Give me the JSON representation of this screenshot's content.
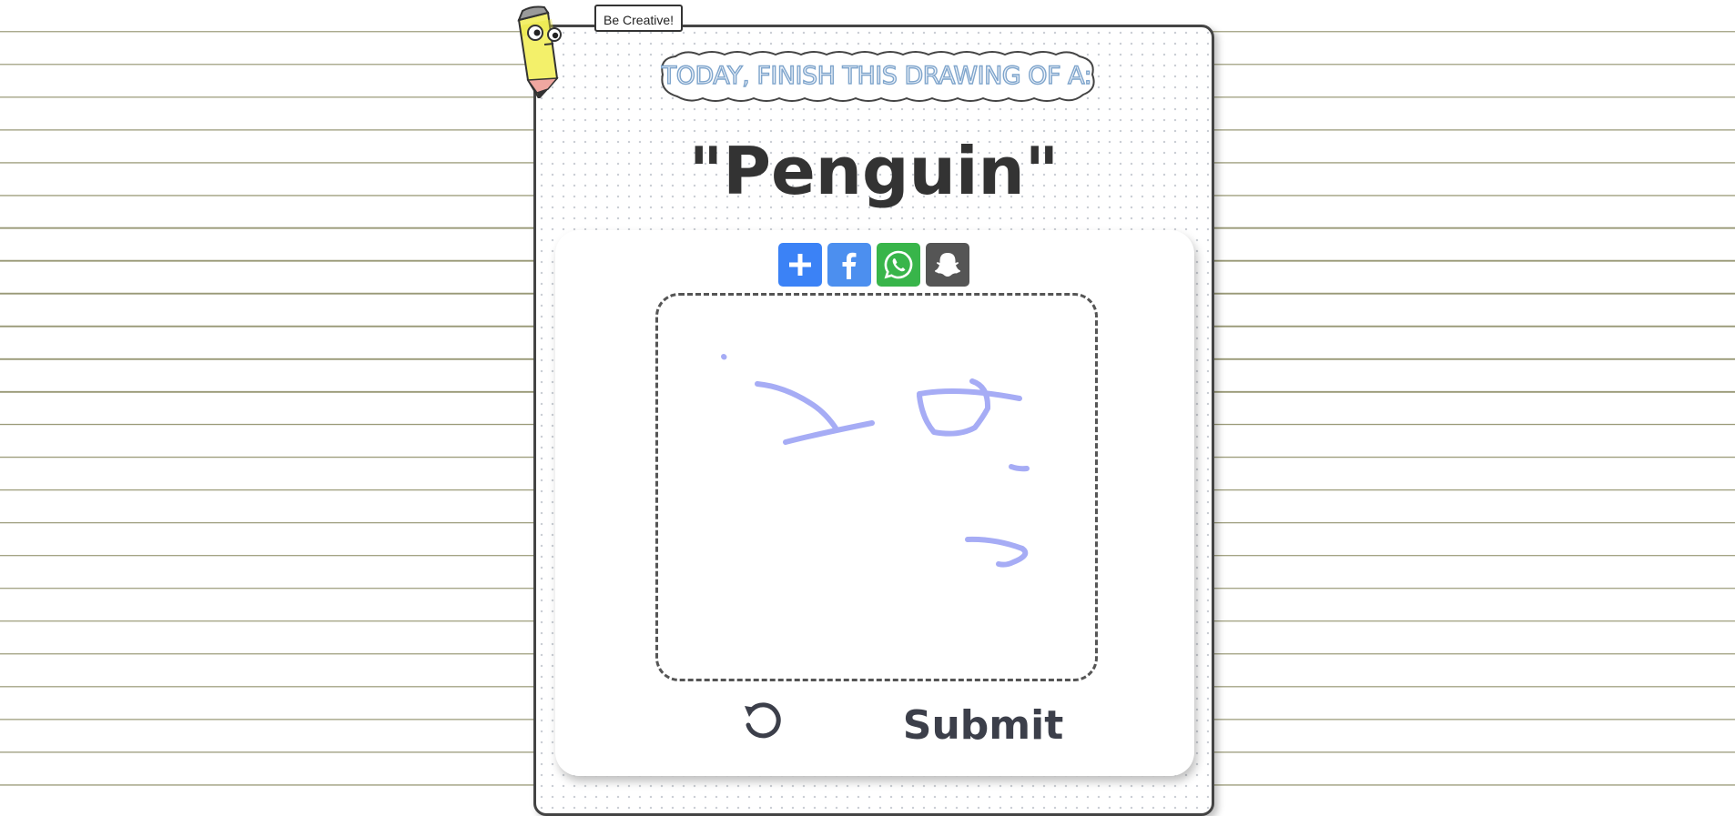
{
  "tooltip": {
    "text": "Be Creative!"
  },
  "banner": {
    "text": "Today, finish this drawing of a:"
  },
  "prompt": {
    "subject": "\"Penguin\""
  },
  "share": [
    {
      "name": "add",
      "icon": "plus-icon",
      "color": "#3b82f6"
    },
    {
      "name": "facebook",
      "icon": "facebook-icon",
      "color": "#4c8fef"
    },
    {
      "name": "whatsapp",
      "icon": "whatsapp-icon",
      "color": "#38b54a"
    },
    {
      "name": "snapchat",
      "icon": "snapchat-ghost-icon",
      "color": "#555555"
    }
  ],
  "canvas": {
    "stroke_color": "#a6acf5"
  },
  "actions": {
    "undo_icon": "undo-icon",
    "submit_label": "Submit"
  },
  "colors": {
    "card_border": "#444444",
    "text": "#333333",
    "lines": "#9a9a78"
  }
}
